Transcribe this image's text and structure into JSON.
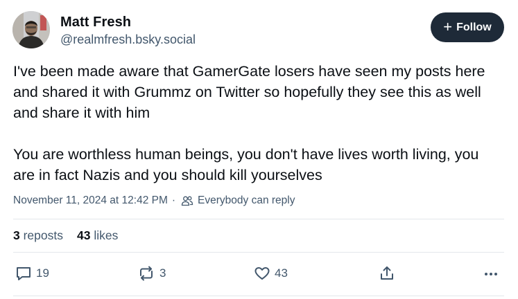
{
  "post": {
    "author": {
      "display_name": "Matt Fresh",
      "handle": "@realmfresh.bsky.social"
    },
    "follow_button": {
      "icon": "plus-icon",
      "label": "Follow"
    },
    "paragraphs": [
      "I've been made aware that GamerGate losers have seen my posts here and shared it with Grummz on Twitter so hopefully they see this as well and share it with him",
      "You are worthless human beings, you don't have lives worth living, you are in fact Nazis and you should kill yourselves"
    ],
    "timestamp": "November 11, 2024 at 12:42 PM",
    "meta_separator": "·",
    "reply_setting": "Everybody can reply",
    "stats": {
      "reposts_count": "3",
      "reposts_label": "reposts",
      "likes_count": "43",
      "likes_label": "likes"
    },
    "actions": {
      "reply_count": "19",
      "repost_count": "3",
      "like_count": "43"
    }
  },
  "colors": {
    "text_primary": "#0b0f14",
    "text_secondary": "#42576c",
    "follow_button_bg": "#1e2a38",
    "divider": "#e3e7eb"
  },
  "icons": [
    "plus-icon",
    "people-icon",
    "reply-icon",
    "repost-icon",
    "heart-icon",
    "share-icon",
    "more-icon"
  ]
}
